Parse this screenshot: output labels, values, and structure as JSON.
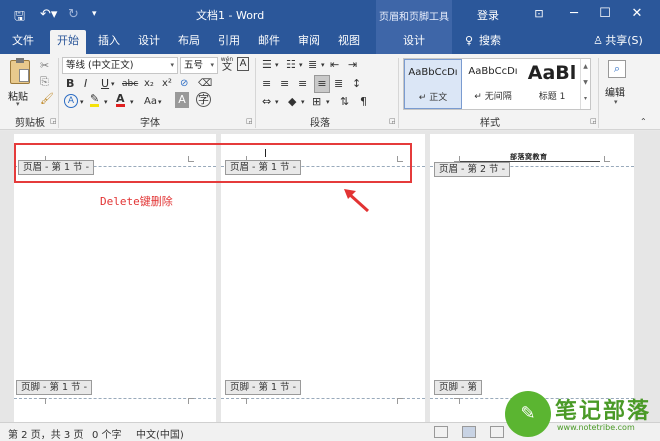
{
  "titlebar": {
    "doc_title": "文档1 - Word",
    "context_title": "页眉和页脚工具",
    "login": "登录",
    "icons": [
      "save-icon",
      "undo-icon",
      "redo-icon",
      "customize-icon"
    ]
  },
  "tabs": {
    "items": [
      "文件",
      "开始",
      "插入",
      "设计",
      "布局",
      "引用",
      "邮件",
      "审阅",
      "视图"
    ],
    "context_tab": "设计",
    "search": "搜索",
    "share": "共享(S)"
  },
  "ribbon": {
    "clipboard": {
      "paste": "粘贴",
      "label": "剪贴板"
    },
    "font": {
      "name": "等线 (中文正文)",
      "size": "五号",
      "wen_icon": "wén",
      "label": "字体",
      "bold": "B",
      "italic": "I",
      "underline": "U",
      "strike": "abc",
      "sub": "x₂",
      "sup": "x²",
      "aa": "Aa",
      "font_color_a": "A",
      "case_a": "A",
      "border_a": "A"
    },
    "paragraph": {
      "label": "段落"
    },
    "styles": {
      "label": "样式",
      "items": [
        {
          "preview": "AaBbCcDı",
          "name": "↵ 正文"
        },
        {
          "preview": "AaBbCcDı",
          "name": "↵ 无间隔"
        },
        {
          "preview": "AaBl",
          "name": "标题 1"
        }
      ]
    },
    "editing": {
      "label": "编辑"
    }
  },
  "document": {
    "pages": [
      {
        "header_tag": "页眉 - 第 1 节 -",
        "footer_tag": "页脚 - 第 1 节 -"
      },
      {
        "header_tag": "页眉 - 第 1 节 -",
        "footer_tag": "页脚 - 第 1 节 -"
      },
      {
        "header_tag": "页眉 - 第 2 节 -",
        "footer_tag": "页脚 - 第",
        "header_text": "部落窝教育"
      }
    ],
    "annotation": "Delete键删除"
  },
  "statusbar": {
    "pages": "第 2 页，共 3 页",
    "words": "0 个字",
    "language": "中文(中国)"
  },
  "watermark": {
    "title": "笔记部落",
    "url": "www.notetribe.com"
  },
  "colors": {
    "accent": "#2b579a",
    "highlight": "#e53b3b"
  }
}
